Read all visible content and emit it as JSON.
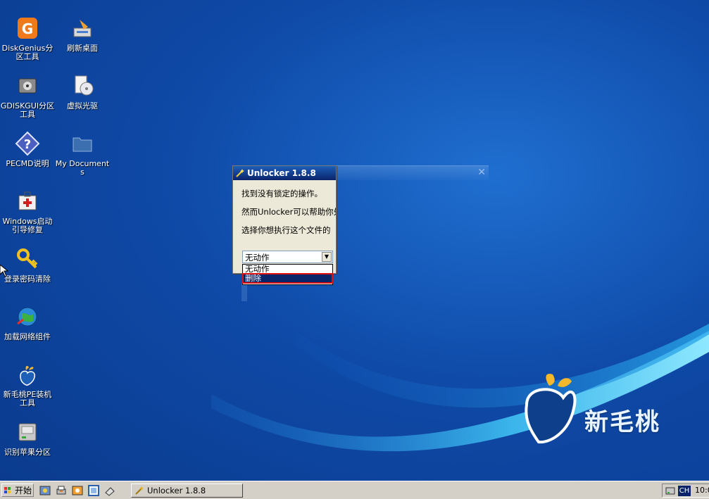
{
  "desktop": {
    "icons": [
      {
        "label": "DiskGenius分区工具",
        "icon": "diskgenius-icon"
      },
      {
        "label": "刷新桌面",
        "icon": "refresh-desktop-icon"
      },
      {
        "label": "GDISKGUI分区工具",
        "icon": "gdiskgui-icon"
      },
      {
        "label": "虚拟光驱",
        "icon": "virtual-drive-icon"
      },
      {
        "label": "PECMD说明",
        "icon": "help-icon"
      },
      {
        "label": "My Documents",
        "icon": "folder-icon"
      },
      {
        "label": "Windows启动引导修复",
        "icon": "repair-kit-icon"
      },
      {
        "label": "登录密码清除",
        "icon": "key-icon"
      },
      {
        "label": "加载网络组件",
        "icon": "network-globe-icon"
      },
      {
        "label": "新毛桃PE装机工具",
        "icon": "peach-icon"
      },
      {
        "label": "识别苹果分区",
        "icon": "drive-icon"
      }
    ],
    "logo_text": "新毛桃"
  },
  "dialog": {
    "title": "Unlocker 1.8.8",
    "line1": "找到没有锁定的操作。",
    "line2": "然而Unlocker可以帮助你处",
    "line3": "选择你想执行这个文件的",
    "combo_value": "无动作",
    "options": [
      "无动作",
      "删除"
    ],
    "selected_option": "删除"
  },
  "taskbar": {
    "start_label": "开始",
    "task_label": "Unlocker 1.8.8",
    "ime_label": "CH",
    "clock": "10:0"
  },
  "colors": {
    "desktop_blue": "#0f4aa8",
    "title_blue": "#0a246a",
    "highlight_red": "#e01010"
  }
}
